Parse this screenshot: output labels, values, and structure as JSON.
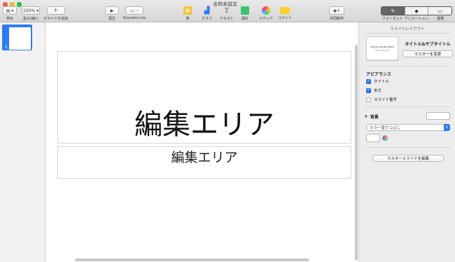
{
  "window": {
    "title": "名称未設定",
    "traffic_lights": {
      "close": "#fc5f57",
      "minimize": "#fdbc2e",
      "zoom": "#28c840"
    }
  },
  "toolbar": {
    "view": {
      "label": "表示",
      "icon": "sidebar-view-icon"
    },
    "zoom": {
      "value": "100%",
      "label": "拡大/縮小"
    },
    "add_slide": {
      "label": "スライドを追加",
      "icon": "plus-icon"
    },
    "play": {
      "label": "再生",
      "icon": "play-icon"
    },
    "keynote_live": {
      "label": "Keynote Live",
      "icon": "keynote-live-icon"
    },
    "table": {
      "label": "表",
      "icon": "table-icon",
      "color": "#f4c430"
    },
    "chart": {
      "label": "グラフ",
      "icon": "chart-icon",
      "color": "#2d7bf4"
    },
    "text": {
      "label": "テキスト",
      "icon": "text-icon"
    },
    "shape": {
      "label": "図形",
      "icon": "shape-icon",
      "color": "#3ac46b"
    },
    "media": {
      "label": "メディア",
      "icon": "media-icon"
    },
    "comment": {
      "label": "コメント",
      "icon": "comment-icon",
      "color": "#f9d22a"
    },
    "collaborate": {
      "label": "共同制作",
      "icon": "collaborate-icon"
    },
    "inspector_tabs": [
      {
        "label": "フォーマット",
        "icon": "format-brush-icon",
        "active": true
      },
      {
        "label": "アニメーション",
        "icon": "animate-diamond-icon",
        "active": false
      },
      {
        "label": "書類",
        "icon": "document-icon",
        "active": false
      }
    ]
  },
  "navigator": {
    "slides": [
      {
        "number": "1",
        "selected": true
      }
    ],
    "selection_color": "#2d7bf4"
  },
  "slide": {
    "title_placeholder": "編集エリア",
    "subtitle_placeholder": "編集エリア"
  },
  "inspector": {
    "header": "スライドレイアウト",
    "master": {
      "thumbnail_title": "Lorem Ipsum Dolor",
      "thumbnail_subtitle": "Dolor sit amet",
      "name": "タイトル&サブタイトル",
      "change_button": "マスターを変更"
    },
    "appearance": {
      "heading": "アピアランス",
      "options": [
        {
          "label": "タイトル",
          "checked": true
        },
        {
          "label": "本文",
          "checked": true
        },
        {
          "label": "スライド番号",
          "checked": false
        }
      ]
    },
    "background": {
      "label": "背景",
      "fill_type": "カラー塗りつぶし"
    },
    "edit_master_button": "マスタースライドを編集"
  }
}
